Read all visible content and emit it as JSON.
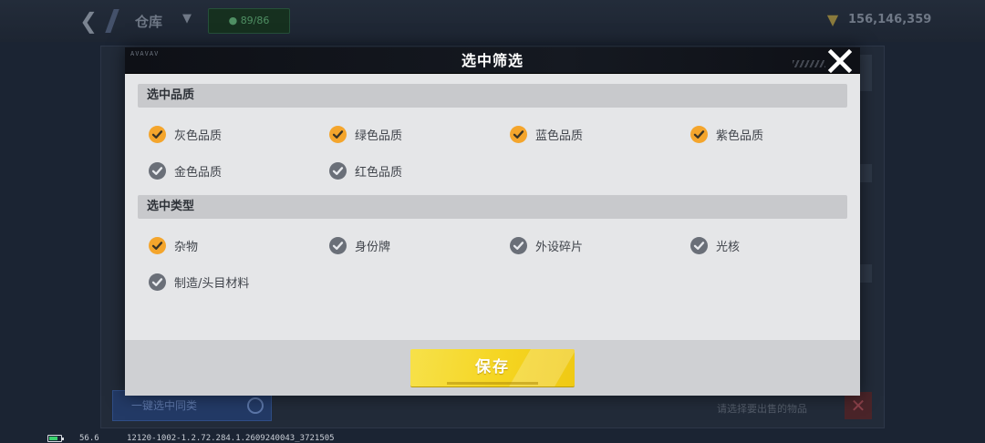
{
  "background": {
    "title": "仓库",
    "dropdown_glyph": "▼",
    "capacity": "● 89/86",
    "currency_icon": "▼",
    "currency_value": "156,146,359",
    "bottom_button": "一键选中同类",
    "bottom_text": "请选择要出售的物品"
  },
  "modal": {
    "header_deco": "AVAVAV",
    "title": "选中筛选",
    "sections": {
      "quality": {
        "header": "选中品质",
        "options": [
          {
            "label": "灰色品质",
            "checked": true
          },
          {
            "label": "绿色品质",
            "checked": true
          },
          {
            "label": "蓝色品质",
            "checked": true
          },
          {
            "label": "紫色品质",
            "checked": true
          },
          {
            "label": "金色品质",
            "checked": false
          },
          {
            "label": "红色品质",
            "checked": false
          }
        ]
      },
      "type": {
        "header": "选中类型",
        "options": [
          {
            "label": "杂物",
            "checked": true
          },
          {
            "label": "身份牌",
            "checked": false
          },
          {
            "label": "外设碎片",
            "checked": false
          },
          {
            "label": "光核",
            "checked": false
          },
          {
            "label": "制造/头目材料",
            "checked": false
          }
        ]
      }
    },
    "save_label": "保存"
  },
  "status_bar": {
    "fps": "56.6",
    "build": "12120-1002-1.2.72.284.1.2609240043_3721505"
  },
  "colors": {
    "checked": "#f4a52c",
    "unchecked": "#6a6f78",
    "save_button": "#f5d521",
    "modal_header": "#0e1016"
  }
}
